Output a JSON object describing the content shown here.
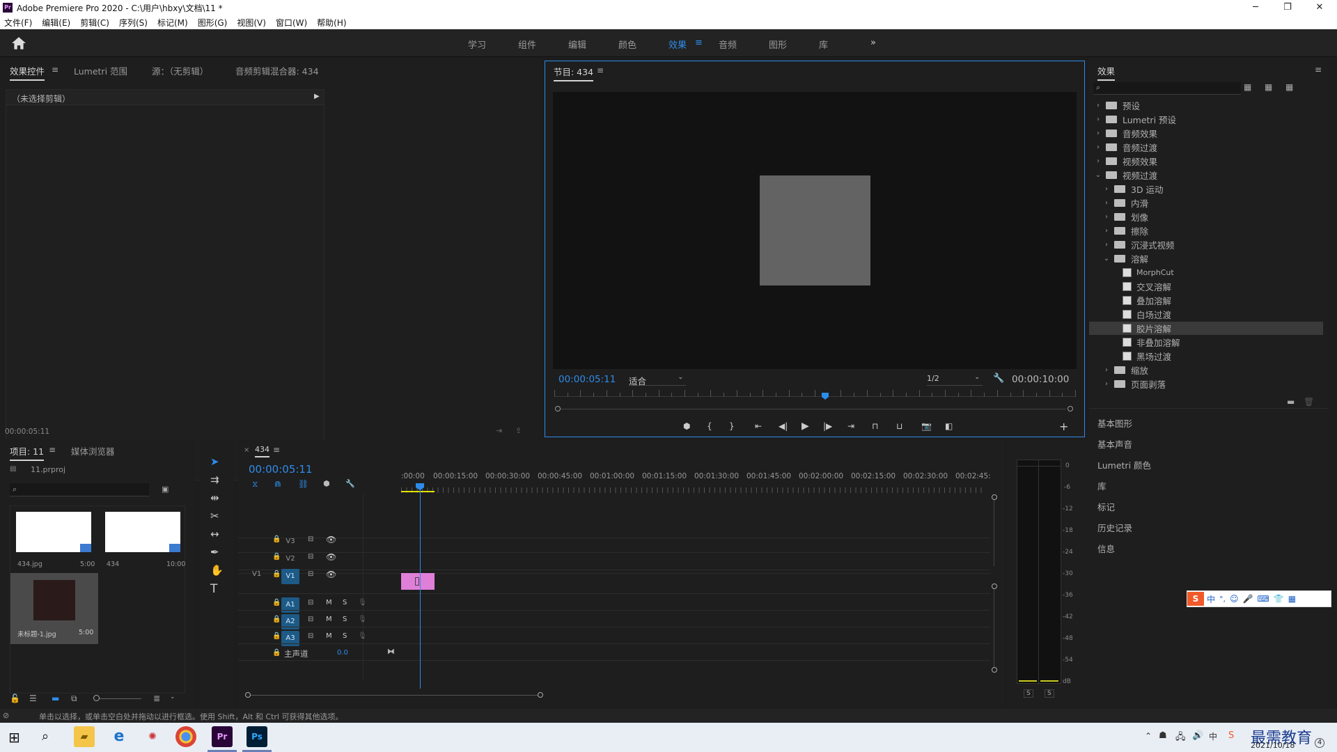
{
  "window": {
    "title": "Adobe Premiere Pro 2020 - C:\\用户\\hbxy\\文档\\11 *",
    "min": "─",
    "max": "❐",
    "close": "✕"
  },
  "menu": [
    "文件(F)",
    "编辑(E)",
    "剪辑(C)",
    "序列(S)",
    "标记(M)",
    "图形(G)",
    "视图(V)",
    "窗口(W)",
    "帮助(H)"
  ],
  "workspaces": [
    "学习",
    "组件",
    "编辑",
    "颜色",
    "效果",
    "音频",
    "图形",
    "库"
  ],
  "workspace_active": "效果",
  "workspace_more": "»",
  "source_panel": {
    "tabs": [
      "效果控件",
      "Lumetri 范围",
      "源：（无剪辑）",
      "音频剪辑混合器: 434"
    ],
    "no_clip": "（未选择剪辑）",
    "timecode": "00:00:05:11"
  },
  "program": {
    "tab": "节目: 434",
    "timecode": "00:00:05:11",
    "fit": "适合",
    "resolution": "1/2",
    "duration": "00:00:10:00",
    "playhead_fraction": 0.52
  },
  "project": {
    "tabs": [
      "项目: 11",
      "媒体浏览器"
    ],
    "file": "11.prproj",
    "items": [
      {
        "name": "434.jpg",
        "duration": "5:00"
      },
      {
        "name": "434",
        "duration": "10:00"
      },
      {
        "name": "未标题-1.jpg",
        "duration": "5:00"
      }
    ]
  },
  "timeline": {
    "close": "×",
    "tab": "434",
    "timecode": "00:00:05:11",
    "ruler": [
      ":00:00",
      "00:00:15:00",
      "00:00:30:00",
      "00:00:45:00",
      "00:01:00:00",
      "00:01:15:00",
      "00:01:30:00",
      "00:01:45:00",
      "00:02:00:00",
      "00:02:15:00",
      "00:02:30:00",
      "00:02:45:"
    ],
    "video_tracks": [
      "V3",
      "V2",
      "V1"
    ],
    "audio_tracks": [
      "A1",
      "A2",
      "A3"
    ],
    "source_label": "V1",
    "master": "主声道",
    "master_value": "0.0",
    "m": "M",
    "s": "S"
  },
  "meter": {
    "labels": [
      "0",
      "-6",
      "-12",
      "-18",
      "-24",
      "-30",
      "-36",
      "-42",
      "-48",
      "-54",
      "dB"
    ],
    "solo": [
      "S",
      "S"
    ]
  },
  "effects": {
    "title": "效果",
    "tree": [
      {
        "label": "预设",
        "level": 0,
        "type": "folder",
        "expanded": false
      },
      {
        "label": "Lumetri 预设",
        "level": 0,
        "type": "folder",
        "expanded": false
      },
      {
        "label": "音频效果",
        "level": 0,
        "type": "folder",
        "expanded": false
      },
      {
        "label": "音频过渡",
        "level": 0,
        "type": "folder",
        "expanded": false
      },
      {
        "label": "视频效果",
        "level": 0,
        "type": "folder",
        "expanded": false
      },
      {
        "label": "视频过渡",
        "level": 0,
        "type": "folder",
        "expanded": true
      },
      {
        "label": "3D 运动",
        "level": 1,
        "type": "folder",
        "expanded": false
      },
      {
        "label": "内滑",
        "level": 1,
        "type": "folder",
        "expanded": false
      },
      {
        "label": "划像",
        "level": 1,
        "type": "folder",
        "expanded": false
      },
      {
        "label": "擦除",
        "level": 1,
        "type": "folder",
        "expanded": false
      },
      {
        "label": "沉浸式视频",
        "level": 1,
        "type": "folder",
        "expanded": false
      },
      {
        "label": "溶解",
        "level": 1,
        "type": "folder",
        "expanded": true
      },
      {
        "label": "MorphCut",
        "level": 2,
        "type": "effect"
      },
      {
        "label": "交叉溶解",
        "level": 2,
        "type": "effect"
      },
      {
        "label": "叠加溶解",
        "level": 2,
        "type": "effect"
      },
      {
        "label": "白场过渡",
        "level": 2,
        "type": "effect"
      },
      {
        "label": "胶片溶解",
        "level": 2,
        "type": "effect",
        "selected": true
      },
      {
        "label": "非叠加溶解",
        "level": 2,
        "type": "effect"
      },
      {
        "label": "黑场过渡",
        "level": 2,
        "type": "effect"
      },
      {
        "label": "缩放",
        "level": 1,
        "type": "folder",
        "expanded": false
      },
      {
        "label": "页面剥落",
        "level": 1,
        "type": "folder",
        "expanded": false
      }
    ],
    "side_panels": [
      "基本图形",
      "基本声音",
      "Lumetri 颜色",
      "库",
      "标记",
      "历史记录",
      "信息"
    ]
  },
  "status": "单击以选择，或单击空白处并拖动以进行框选。使用 Shift，Alt 和 Ctrl 可获得其他选项。",
  "ime": [
    "中",
    "°,",
    "☺",
    "🎤",
    "⌨",
    "👕",
    "▦"
  ],
  "taskbar": {
    "date": "2021/10/18",
    "watermark": "最需教育",
    "notify": "4"
  },
  "colors": {
    "accent": "#2d8ceb",
    "clip": "#e07fd8",
    "track_on": "#1d5a86"
  }
}
